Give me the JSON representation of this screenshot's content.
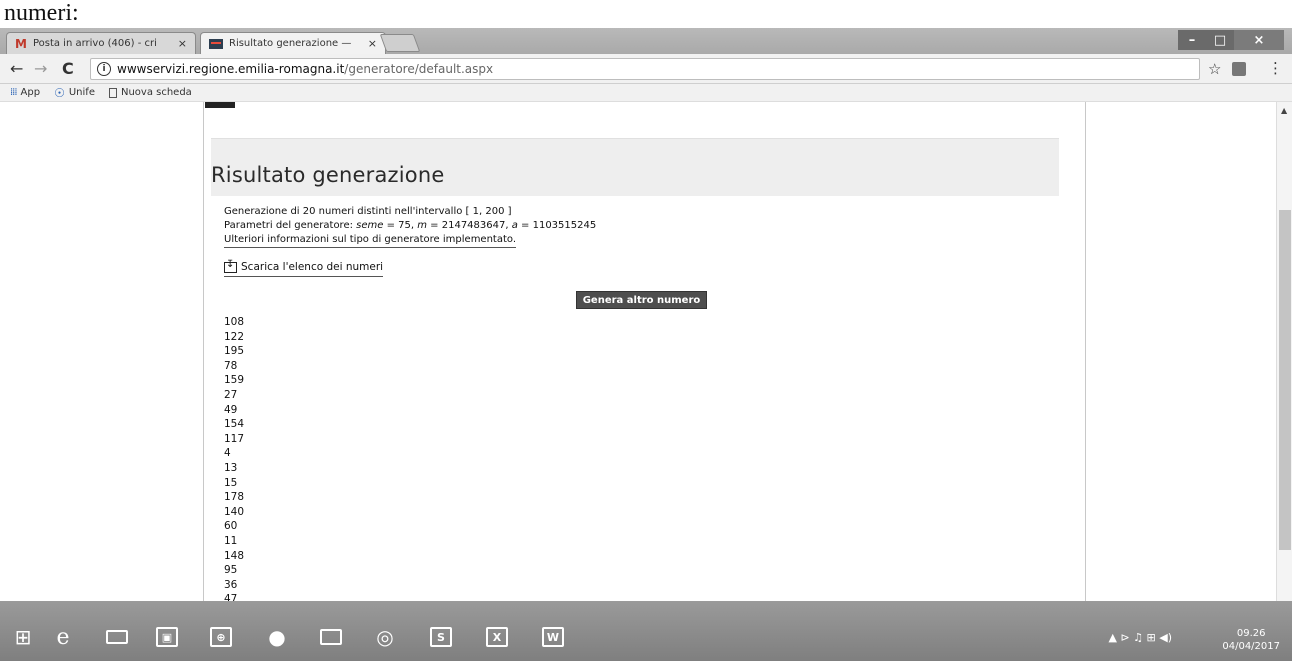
{
  "doc_caption": "numeri:",
  "browser": {
    "tabs": [
      {
        "label": "Posta in arrivo (406) - cri",
        "close": "×"
      },
      {
        "label": "Risultato generazione —",
        "close": "×"
      }
    ],
    "window_controls": {
      "minimize": "–",
      "maximize": "□",
      "close": "×"
    },
    "nav": {
      "back": "←",
      "forward": "→",
      "reload": "C"
    },
    "address": {
      "info": "i",
      "domain": "wwwservizi.regione.emilia-romagna.it",
      "path": "/generatore/default.aspx"
    },
    "star": "☆",
    "menu": "⋮",
    "bookmarks": [
      {
        "label": "App"
      },
      {
        "label": "Unife"
      },
      {
        "label": "Nuova scheda"
      }
    ]
  },
  "page": {
    "title": "Risultato generazione",
    "line1": "Generazione di 20 numeri distinti nell'intervallo [ 1, 200 ]",
    "line2_prefix": "Parametri del generatore: ",
    "seed_label": "seme",
    "seed_value": " = 75, ",
    "m_label": "m",
    "m_value": " = 2147483647, ",
    "a_label": "a",
    "a_value": " = 1103515245",
    "line3": "Ulteriori informazioni sul tipo di generatore implementato.",
    "download_label": "Scarica l'elenco dei numeri",
    "generate_button": "Genera altro numero",
    "numbers": [
      "108",
      "122",
      "195",
      "78",
      "159",
      "27",
      "49",
      "154",
      "117",
      "4",
      "13",
      "15",
      "178",
      "140",
      "60",
      "11",
      "148",
      "95",
      "36",
      "47"
    ]
  },
  "taskbar": {
    "clock_time": "09.26",
    "clock_date": "04/04/2017",
    "tray": "▲ ⊳ ♫ ⊞ ◀)"
  },
  "colors": {
    "button_bg": "#4e4e4e",
    "heading_bg": "#eeeeee",
    "taskbar": "#8a8a8a"
  }
}
